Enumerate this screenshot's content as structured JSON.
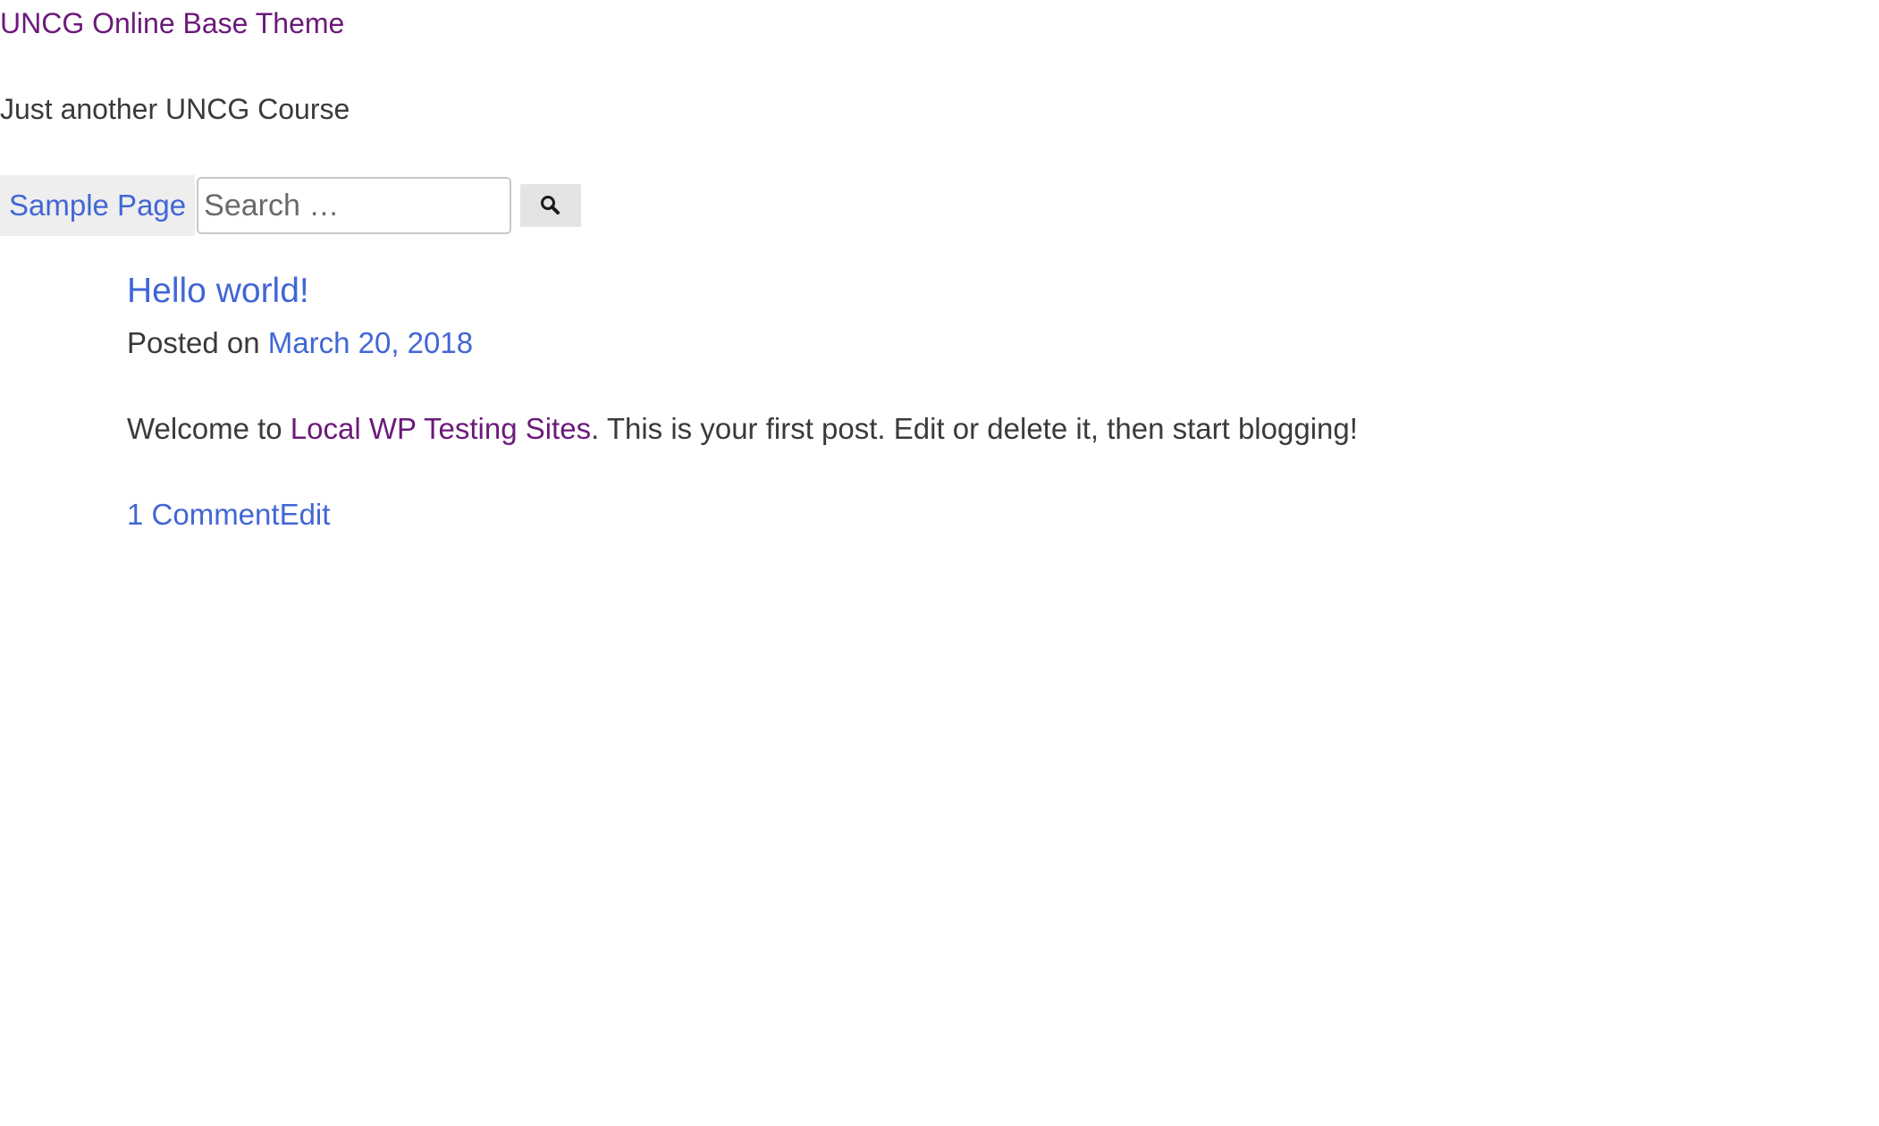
{
  "site": {
    "title": "UNCG Online Base Theme",
    "description": "Just another UNCG Course"
  },
  "nav": {
    "items": [
      {
        "label": "Sample Page"
      }
    ]
  },
  "search": {
    "placeholder": "Search …",
    "button_icon": "search-icon"
  },
  "post": {
    "title": "Hello world!",
    "meta_prefix": "Posted on ",
    "date": "March 20, 2018",
    "body_before": "Welcome to ",
    "body_link": "Local WP Testing Sites",
    "body_after": ". This is your first post. Edit or delete it, then start blogging!",
    "comments_link": "1 Comment",
    "edit_link": "Edit"
  },
  "colors": {
    "link": "#4166d5",
    "visited_link": "#6b1a7a",
    "text": "#3a3a3a",
    "nav_bg": "#eeeeee"
  }
}
